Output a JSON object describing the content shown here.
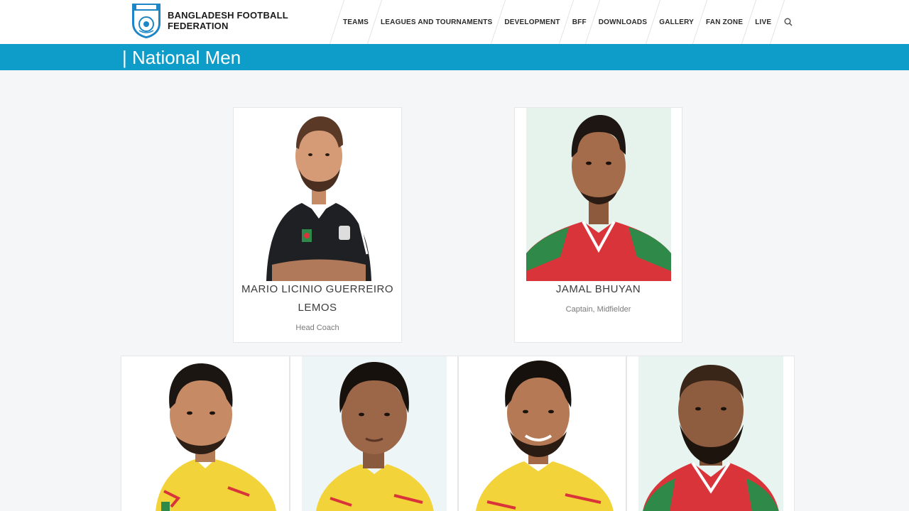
{
  "header": {
    "brand_line1": "BANGLADESH FOOTBALL",
    "brand_line2": "FEDERATION",
    "nav": [
      {
        "label": "TEAMS"
      },
      {
        "label": "LEAGUES AND TOURNAMENTS"
      },
      {
        "label": "DEVELOPMENT"
      },
      {
        "label": "BFF"
      },
      {
        "label": "DOWNLOADS"
      },
      {
        "label": "GALLERY"
      },
      {
        "label": "FAN ZONE"
      },
      {
        "label": "LIVE"
      }
    ]
  },
  "page": {
    "title": "| National Men"
  },
  "staff": [
    {
      "name_line1": "MARIO LICINIO GUERREIRO",
      "name_line2": "LEMOS",
      "role": "Head Coach"
    },
    {
      "name_line1": "JAMAL BHUYAN",
      "role": "Captain, Midfielder"
    }
  ],
  "colors": {
    "accent": "#0e9cc8",
    "background": "#f4f6f8",
    "jersey_red": "#d8343a",
    "jersey_green": "#2f8a4a",
    "jersey_yellow": "#f3d33a"
  }
}
